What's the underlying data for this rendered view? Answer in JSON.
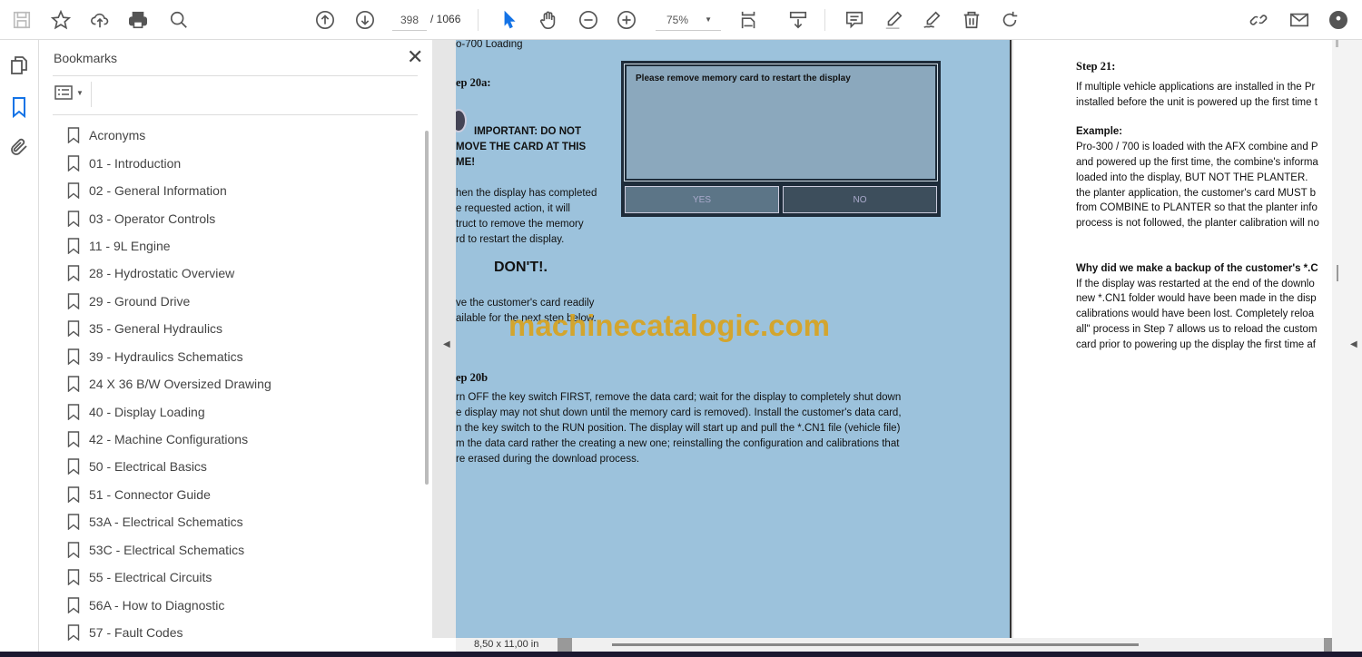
{
  "toolbar": {
    "page_current": "398",
    "page_total": "/ 1066",
    "zoom": "75%"
  },
  "panel": {
    "title": "Bookmarks",
    "items": [
      "Acronyms",
      "01 - Introduction",
      "02 - General Information",
      "03 - Operator Controls",
      "11 - 9L Engine",
      "28 - Hydrostatic Overview",
      "29 - Ground Drive",
      "35 - General Hydraulics",
      "39 - Hydraulics Schematics",
      "24 X 36 B/W Oversized Drawing",
      "40 - Display Loading",
      "42 - Machine Configurations",
      "50 - Electrical Basics",
      "51 - Connector Guide",
      "53A - Electrical Schematics",
      "53C - Electrical Schematics",
      "55 - Electrical Circuits",
      "56A - How to Diagnostic",
      "57 - Fault Codes"
    ]
  },
  "page1": {
    "header": "o-700  Loading",
    "step20a": "ep 20a:",
    "important": [
      "IMPORTANT:  DO NOT",
      "MOVE THE CARD AT THIS",
      "ME!"
    ],
    "para1": [
      "hen the display has completed",
      "e requested action, it will",
      "truct to remove the memory",
      "rd to restart the display."
    ],
    "dont": "DON'T!.",
    "para2": [
      "ve the customer's card readily",
      "ailable for the next step below."
    ],
    "dialog_msg": "Please remove memory card to restart the display",
    "dialog_yes": "YES",
    "dialog_no": "NO",
    "step20b": "ep 20b",
    "para3": [
      "rn OFF the key switch FIRST, remove the data card; wait for the display to completely shut down",
      "e display may not shut down until the memory card is removed).  Install the customer's data card,",
      "n the key switch to the RUN position.  The display will start up and pull the *.CN1 file (vehicle file)",
      "m the data card rather the creating a new one; reinstalling the configuration and calibrations that",
      "re erased during the download process."
    ]
  },
  "watermark": "machinecatalogic.com",
  "page2": {
    "step21": "Step 21:",
    "para1": [
      "If multiple vehicle applications are installed in the Pr",
      "installed before the unit is powered up the first time t"
    ],
    "example": "Example:",
    "para2": [
      "Pro-300 / 700 is loaded with the AFX combine and P",
      "and powered up the first time, the combine's informa",
      "loaded into the display, BUT NOT THE PLANTER.",
      "the planter application, the customer's card MUST b",
      "from COMBINE to PLANTER so that the planter info",
      "process is not followed, the planter calibration will no"
    ],
    "why": "Why did we make a backup of the customer's *.C",
    "para3": [
      "If the display was restarted at the end of the downlo",
      "new *.CN1 folder would have been made in the disp",
      "calibrations would have been lost.  Completely reloa",
      "all\" process in Step 7 allows us to reload the custom",
      "card prior to powering up the display the first time af"
    ]
  },
  "status": {
    "page_size": "8,50 x 11,00 in"
  },
  "colors": {
    "page_blue": "#9cc2dc",
    "accent": "#1473e6",
    "watermark": "#d9a21c"
  }
}
